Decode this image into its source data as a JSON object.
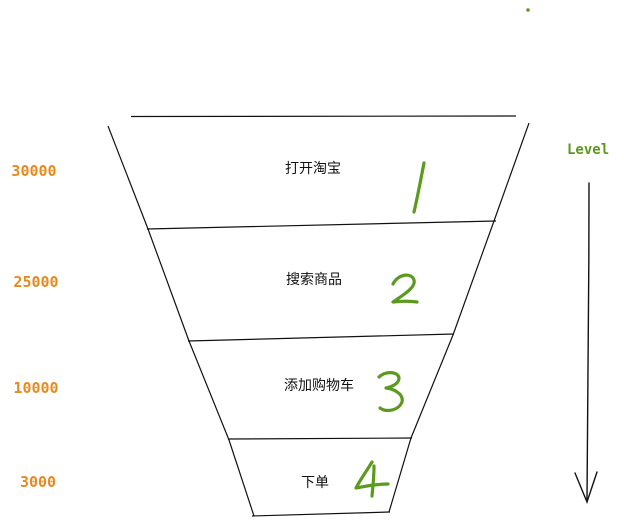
{
  "colors": {
    "count": "#e8891e",
    "handwriting": "#5c9a1f",
    "line": "#111111"
  },
  "funnel": {
    "stages": [
      {
        "label": "打开淘宝",
        "count": "30000",
        "number": "1"
      },
      {
        "label": "搜索商品",
        "count": "25000",
        "number": "2"
      },
      {
        "label": "添加购物车",
        "count": "10000",
        "number": "3"
      },
      {
        "label": "下单",
        "count": "3000",
        "number": "4"
      }
    ]
  },
  "level_arrow": {
    "label": "Level",
    "direction": "down"
  }
}
